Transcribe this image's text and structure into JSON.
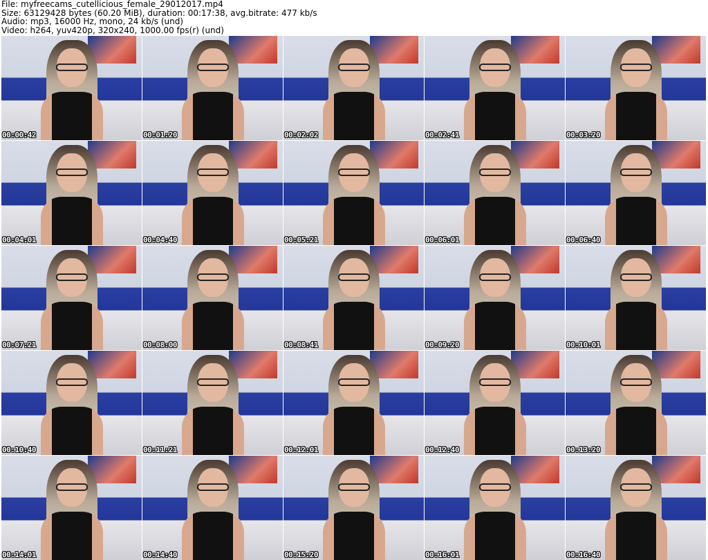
{
  "header": {
    "file": "File: myfreecams_cutellicious_female_29012017.mp4",
    "size": "Size: 63129428 bytes (60.20 MiB), duration: 00:17:38, avg.bitrate: 477 kb/s",
    "audio": "Audio: mp3, 16000 Hz, mono, 24 kb/s (und)",
    "video": "Video: h264, yuv420p, 320x240, 1000.00 fps(r) (und)"
  },
  "thumbnails": [
    "00:00:42",
    "00:01:20",
    "00:02:02",
    "00:02:41",
    "00:03:20",
    "00:04:01",
    "00:04:40",
    "00:05:21",
    "00:06:01",
    "00:06:40",
    "00:07:21",
    "00:08:00",
    "00:08:41",
    "00:09:20",
    "00:10:01",
    "00:10:40",
    "00:11:21",
    "00:12:01",
    "00:12:40",
    "00:13:20",
    "00:14:01",
    "00:14:40",
    "00:15:20",
    "00:16:01",
    "00:16:40"
  ]
}
